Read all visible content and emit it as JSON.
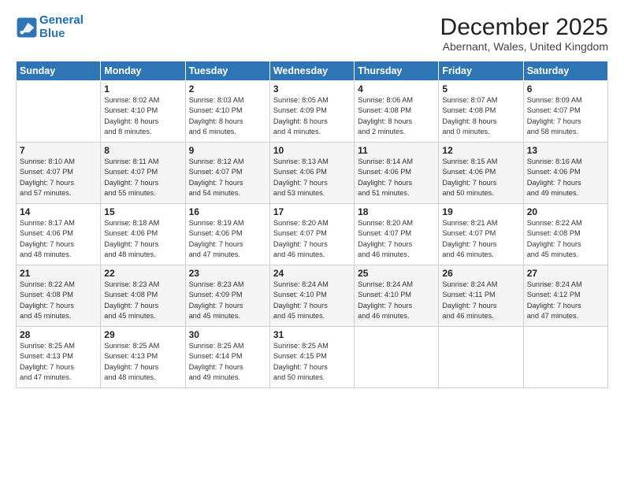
{
  "logo": {
    "line1": "General",
    "line2": "Blue"
  },
  "title": "December 2025",
  "subtitle": "Abernant, Wales, United Kingdom",
  "days_of_week": [
    "Sunday",
    "Monday",
    "Tuesday",
    "Wednesday",
    "Thursday",
    "Friday",
    "Saturday"
  ],
  "weeks": [
    [
      {
        "day": "",
        "sunrise": "",
        "sunset": "",
        "daylight": ""
      },
      {
        "day": "1",
        "sunrise": "Sunrise: 8:02 AM",
        "sunset": "Sunset: 4:10 PM",
        "daylight": "Daylight: 8 hours and 8 minutes."
      },
      {
        "day": "2",
        "sunrise": "Sunrise: 8:03 AM",
        "sunset": "Sunset: 4:10 PM",
        "daylight": "Daylight: 8 hours and 6 minutes."
      },
      {
        "day": "3",
        "sunrise": "Sunrise: 8:05 AM",
        "sunset": "Sunset: 4:09 PM",
        "daylight": "Daylight: 8 hours and 4 minutes."
      },
      {
        "day": "4",
        "sunrise": "Sunrise: 8:06 AM",
        "sunset": "Sunset: 4:08 PM",
        "daylight": "Daylight: 8 hours and 2 minutes."
      },
      {
        "day": "5",
        "sunrise": "Sunrise: 8:07 AM",
        "sunset": "Sunset: 4:08 PM",
        "daylight": "Daylight: 8 hours and 0 minutes."
      },
      {
        "day": "6",
        "sunrise": "Sunrise: 8:09 AM",
        "sunset": "Sunset: 4:07 PM",
        "daylight": "Daylight: 7 hours and 58 minutes."
      }
    ],
    [
      {
        "day": "7",
        "sunrise": "Sunrise: 8:10 AM",
        "sunset": "Sunset: 4:07 PM",
        "daylight": "Daylight: 7 hours and 57 minutes."
      },
      {
        "day": "8",
        "sunrise": "Sunrise: 8:11 AM",
        "sunset": "Sunset: 4:07 PM",
        "daylight": "Daylight: 7 hours and 55 minutes."
      },
      {
        "day": "9",
        "sunrise": "Sunrise: 8:12 AM",
        "sunset": "Sunset: 4:07 PM",
        "daylight": "Daylight: 7 hours and 54 minutes."
      },
      {
        "day": "10",
        "sunrise": "Sunrise: 8:13 AM",
        "sunset": "Sunset: 4:06 PM",
        "daylight": "Daylight: 7 hours and 53 minutes."
      },
      {
        "day": "11",
        "sunrise": "Sunrise: 8:14 AM",
        "sunset": "Sunset: 4:06 PM",
        "daylight": "Daylight: 7 hours and 51 minutes."
      },
      {
        "day": "12",
        "sunrise": "Sunrise: 8:15 AM",
        "sunset": "Sunset: 4:06 PM",
        "daylight": "Daylight: 7 hours and 50 minutes."
      },
      {
        "day": "13",
        "sunrise": "Sunrise: 8:16 AM",
        "sunset": "Sunset: 4:06 PM",
        "daylight": "Daylight: 7 hours and 49 minutes."
      }
    ],
    [
      {
        "day": "14",
        "sunrise": "Sunrise: 8:17 AM",
        "sunset": "Sunset: 4:06 PM",
        "daylight": "Daylight: 7 hours and 48 minutes."
      },
      {
        "day": "15",
        "sunrise": "Sunrise: 8:18 AM",
        "sunset": "Sunset: 4:06 PM",
        "daylight": "Daylight: 7 hours and 48 minutes."
      },
      {
        "day": "16",
        "sunrise": "Sunrise: 8:19 AM",
        "sunset": "Sunset: 4:06 PM",
        "daylight": "Daylight: 7 hours and 47 minutes."
      },
      {
        "day": "17",
        "sunrise": "Sunrise: 8:20 AM",
        "sunset": "Sunset: 4:07 PM",
        "daylight": "Daylight: 7 hours and 46 minutes."
      },
      {
        "day": "18",
        "sunrise": "Sunrise: 8:20 AM",
        "sunset": "Sunset: 4:07 PM",
        "daylight": "Daylight: 7 hours and 46 minutes."
      },
      {
        "day": "19",
        "sunrise": "Sunrise: 8:21 AM",
        "sunset": "Sunset: 4:07 PM",
        "daylight": "Daylight: 7 hours and 46 minutes."
      },
      {
        "day": "20",
        "sunrise": "Sunrise: 8:22 AM",
        "sunset": "Sunset: 4:08 PM",
        "daylight": "Daylight: 7 hours and 45 minutes."
      }
    ],
    [
      {
        "day": "21",
        "sunrise": "Sunrise: 8:22 AM",
        "sunset": "Sunset: 4:08 PM",
        "daylight": "Daylight: 7 hours and 45 minutes."
      },
      {
        "day": "22",
        "sunrise": "Sunrise: 8:23 AM",
        "sunset": "Sunset: 4:08 PM",
        "daylight": "Daylight: 7 hours and 45 minutes."
      },
      {
        "day": "23",
        "sunrise": "Sunrise: 8:23 AM",
        "sunset": "Sunset: 4:09 PM",
        "daylight": "Daylight: 7 hours and 45 minutes."
      },
      {
        "day": "24",
        "sunrise": "Sunrise: 8:24 AM",
        "sunset": "Sunset: 4:10 PM",
        "daylight": "Daylight: 7 hours and 45 minutes."
      },
      {
        "day": "25",
        "sunrise": "Sunrise: 8:24 AM",
        "sunset": "Sunset: 4:10 PM",
        "daylight": "Daylight: 7 hours and 46 minutes."
      },
      {
        "day": "26",
        "sunrise": "Sunrise: 8:24 AM",
        "sunset": "Sunset: 4:11 PM",
        "daylight": "Daylight: 7 hours and 46 minutes."
      },
      {
        "day": "27",
        "sunrise": "Sunrise: 8:24 AM",
        "sunset": "Sunset: 4:12 PM",
        "daylight": "Daylight: 7 hours and 47 minutes."
      }
    ],
    [
      {
        "day": "28",
        "sunrise": "Sunrise: 8:25 AM",
        "sunset": "Sunset: 4:13 PM",
        "daylight": "Daylight: 7 hours and 47 minutes."
      },
      {
        "day": "29",
        "sunrise": "Sunrise: 8:25 AM",
        "sunset": "Sunset: 4:13 PM",
        "daylight": "Daylight: 7 hours and 48 minutes."
      },
      {
        "day": "30",
        "sunrise": "Sunrise: 8:25 AM",
        "sunset": "Sunset: 4:14 PM",
        "daylight": "Daylight: 7 hours and 49 minutes."
      },
      {
        "day": "31",
        "sunrise": "Sunrise: 8:25 AM",
        "sunset": "Sunset: 4:15 PM",
        "daylight": "Daylight: 7 hours and 50 minutes."
      },
      {
        "day": "",
        "sunrise": "",
        "sunset": "",
        "daylight": ""
      },
      {
        "day": "",
        "sunrise": "",
        "sunset": "",
        "daylight": ""
      },
      {
        "day": "",
        "sunrise": "",
        "sunset": "",
        "daylight": ""
      }
    ]
  ]
}
